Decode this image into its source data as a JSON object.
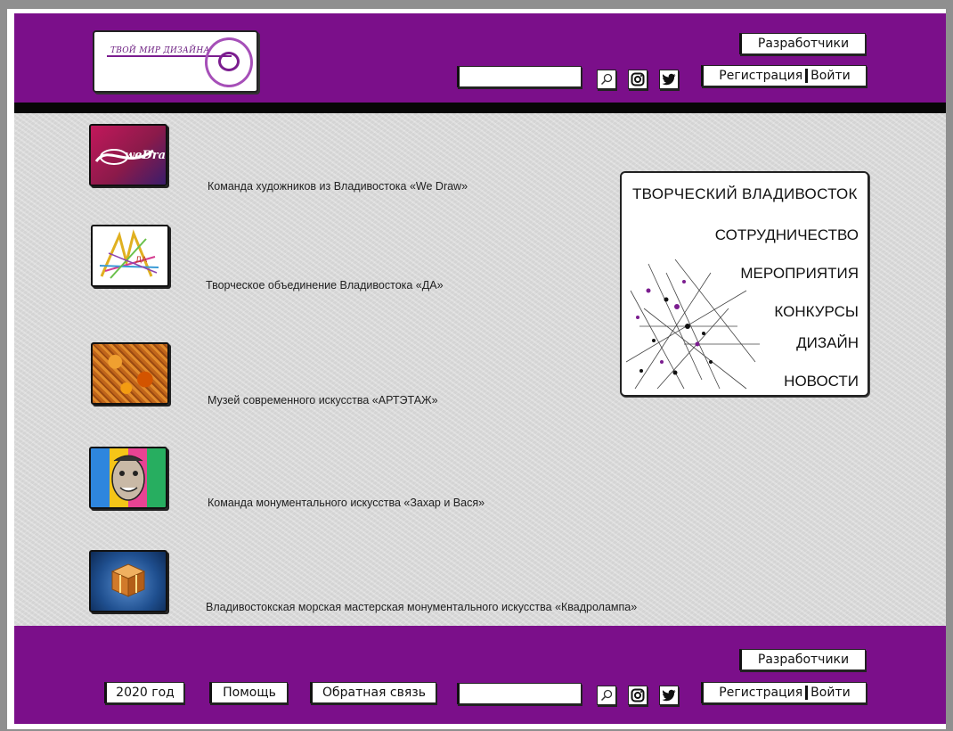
{
  "header": {
    "logo_text": "ТВОЙ МИР ДИЗАЙНА",
    "developers_label": "Разработчики",
    "search_value": "",
    "register_label": "Регистрация",
    "login_label": "Войти"
  },
  "items": [
    {
      "label": "Команда художников из Владивостока   «We Draw»",
      "thumb_text": "weDraw"
    },
    {
      "label": "Творческое объединение Владивостока «ДА»",
      "thumb_text": "ДА"
    },
    {
      "label": "Музей современного искусства «АРТЭТАЖ»"
    },
    {
      "label": "Команда монументального искусства «Захар и Вася»"
    },
    {
      "label": "Владивостокская морская мастерская монументального искусства «Квадролампа»"
    }
  ],
  "menu_card": {
    "title": "ТВОРЧЕСКИЙ ВЛАДИВОСТОК",
    "links": [
      "СОТРУДНИЧЕСТВО",
      "МЕРОПРИЯТИЯ",
      "КОНКУРСЫ",
      "ДИЗАЙН",
      "НОВОСТИ"
    ]
  },
  "footer": {
    "developers_label": "Разработчики",
    "year_label": "2020 год",
    "help_label": "Помощь",
    "feedback_label": "Обратная связь",
    "search_value": "",
    "register_label": "Регистрация",
    "login_label": "Войти"
  },
  "icons": [
    "search-icon",
    "instagram-icon",
    "twitter-icon"
  ],
  "colors": {
    "brand_purple": "#7b0f8a",
    "rule_black": "#060606",
    "accent_pink": "#a64fb8"
  }
}
